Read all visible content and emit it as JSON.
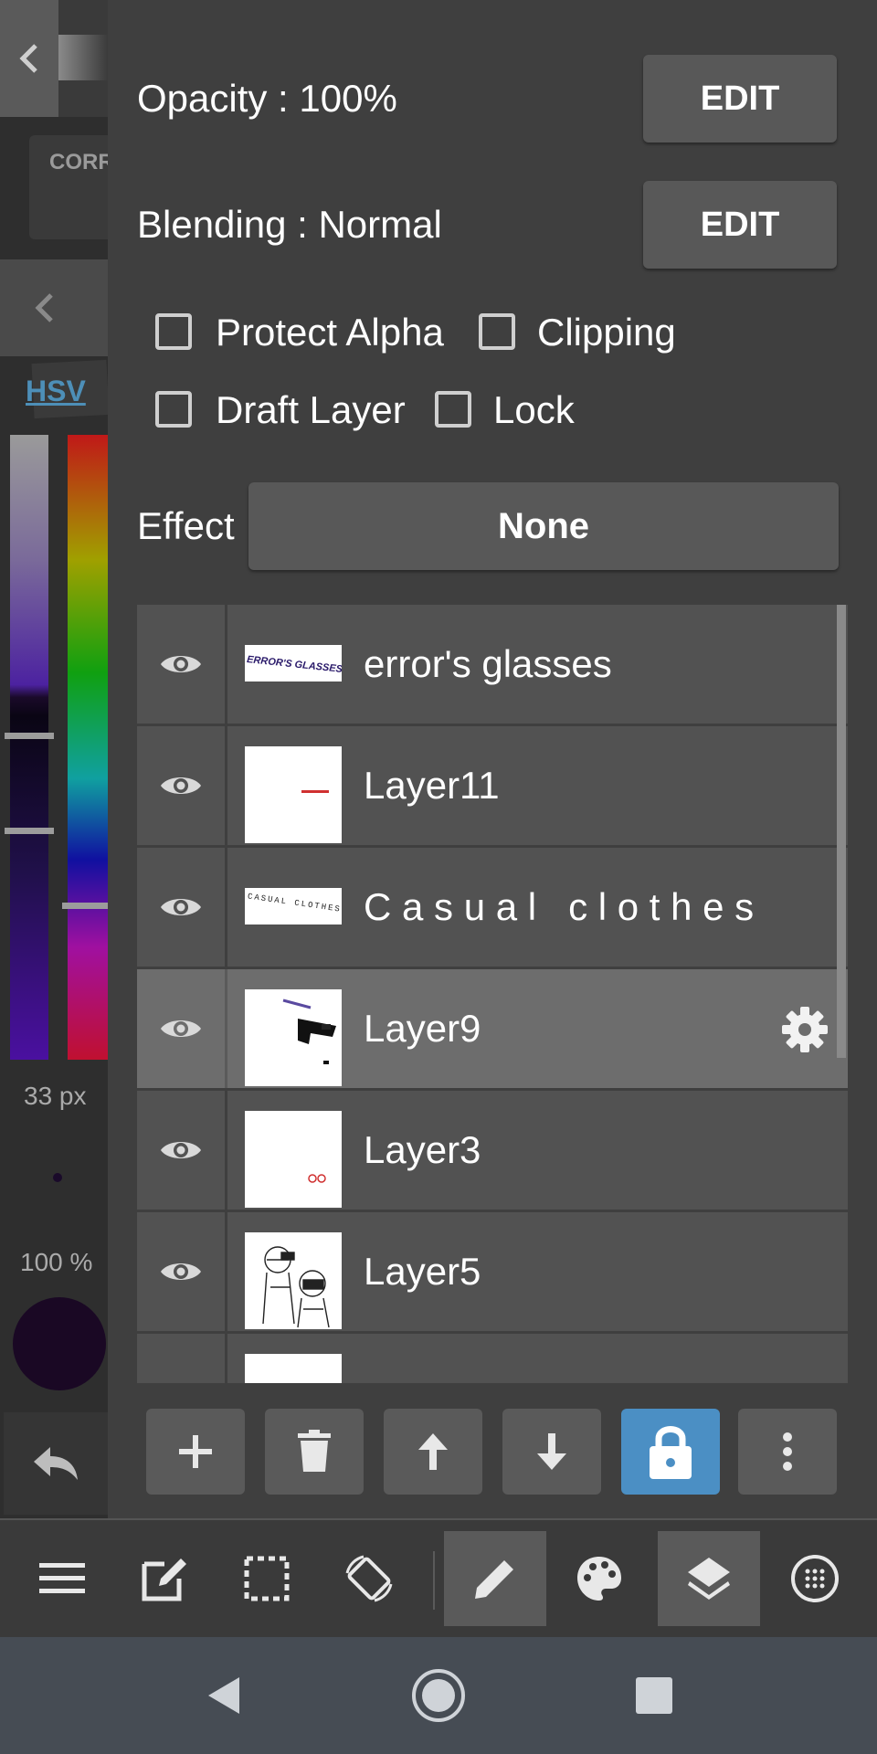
{
  "left_strip": {
    "corr_label": "CORR",
    "hsv_label": "HSV",
    "brush_size": "33 px",
    "brush_opacity": "100 %"
  },
  "layer_props": {
    "opacity_label": "Opacity : 100%",
    "blending_label": "Blending : Normal",
    "edit_label": "EDIT",
    "checkboxes": {
      "protect_alpha": "Protect Alpha",
      "clipping": "Clipping",
      "draft_layer": "Draft Layer",
      "lock": "Lock"
    },
    "effect_label": "Effect",
    "effect_value": "None"
  },
  "layers": [
    {
      "name": "error's glasses",
      "thumb_text": "ERROR'S GLASSES",
      "visible": true,
      "selected": false
    },
    {
      "name": "Layer11",
      "visible": true,
      "selected": false
    },
    {
      "name": "C a s u a l   c l o t h e s",
      "thumb_text": "CASUAL CLOTHES",
      "visible": true,
      "selected": false
    },
    {
      "name": "Layer9",
      "visible": true,
      "selected": true
    },
    {
      "name": "Layer3",
      "visible": true,
      "selected": false
    },
    {
      "name": "Layer5",
      "visible": true,
      "selected": false
    }
  ],
  "actions": [
    "add-icon",
    "trash-icon",
    "arrow-up-icon",
    "arrow-down-icon",
    "lock-icon",
    "more-vertical-icon"
  ],
  "toolbar": [
    "menu-icon",
    "edit-square-icon",
    "selection-icon",
    "rotate-screen-icon",
    "pencil-icon",
    "palette-icon",
    "layers-icon",
    "grid-circle-icon"
  ],
  "colors": {
    "accent": "#4b8fc4",
    "hsv_link": "#4d8fb8",
    "panel_bg": "#3f3f3f",
    "row_bg": "#525252",
    "row_selected": "#6d6d6d"
  }
}
